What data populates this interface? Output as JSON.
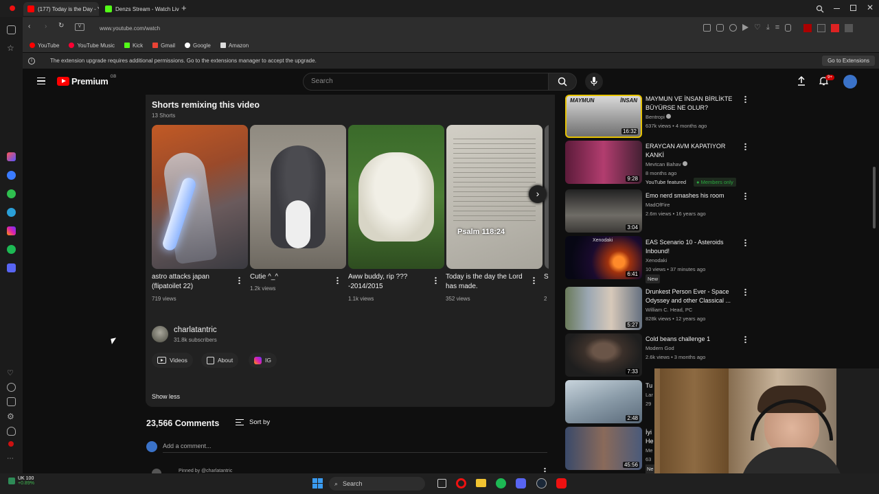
{
  "browser": {
    "tabs": [
      {
        "label": "(177) Today is the Day - Y"
      },
      {
        "label": "Denzs Stream - Watch Liv"
      }
    ],
    "url": "www.youtube.com/watch",
    "bookmarks": [
      "YouTube",
      "YouTube Music",
      "Kick",
      "Gmail",
      "Google",
      "Amazon"
    ],
    "info_message": "The extension upgrade requires additional permissions. Go to the extensions manager to accept the upgrade.",
    "info_button": "Go to Extensions"
  },
  "youtube": {
    "logo": "Premium",
    "logo_badge": "GB",
    "search_placeholder": "Search",
    "notifications_badge": "9+"
  },
  "shorts": {
    "heading": "Shorts remixing this video",
    "count": "13 Shorts",
    "items": [
      {
        "title": "astro attacks japan (flipatoilet 22)",
        "views": "719 views"
      },
      {
        "title": "Cutie ^_^",
        "views": "1.2k views"
      },
      {
        "title": "Aww buddy, rip ??? -2014/2015",
        "views": "1.1k views"
      },
      {
        "title": "Today is the day the Lord has made.",
        "views": "352 views"
      },
      {
        "title": "S",
        "views": "2"
      }
    ],
    "psalm_text": "Psalm 118:24"
  },
  "channel": {
    "name": "charlatantric",
    "subscribers": "31.8k subscribers",
    "chips": [
      "Videos",
      "About",
      "IG"
    ],
    "show_less": "Show less"
  },
  "comments": {
    "count": "23,566 Comments",
    "sort": "Sort by",
    "add_placeholder": "Add a comment...",
    "pinned": "Pinned by @charlatantric"
  },
  "related": [
    {
      "title": "MAYMUN VE İNSAN BİRLİKTE BÜYÜRSE NE OLUR?",
      "channel": "Bentropi",
      "meta": "637k views • 4 months ago",
      "duration": "16:32",
      "thumb_text_left": "MAYMUN",
      "thumb_text_right": "İNSAN"
    },
    {
      "title": "ERAYCAN AVM KAPATIYOR KANKİ",
      "channel": "Mevtcan Bahav",
      "meta": "8 months ago",
      "duration": "9:28",
      "badge1": "YouTube featured",
      "badge2": "Members only"
    },
    {
      "title": "Emo nerd smashes his room",
      "channel": "MadOfFire",
      "meta": "2.6m views • 16 years ago",
      "duration": "3:04"
    },
    {
      "title": "EAS Scenario 10 - Asteroids Inbound!",
      "channel": "Xenodaki",
      "meta": "10 views • 37 minutes ago",
      "duration": "6:41",
      "badge1": "New",
      "thumb_text": "Xenodaki"
    },
    {
      "title": "Drunkest Person Ever - Space Odyssey and other Classical ...",
      "channel": "William C. Head, PC",
      "meta": "828k views • 12 years ago",
      "duration": "5:27"
    },
    {
      "title": "Cold beans challenge 1",
      "channel": "Modern God",
      "meta": "2.6k views • 3 months ago",
      "duration": "7:33"
    },
    {
      "title": "Tu",
      "channel": "Lar",
      "meta": "29",
      "duration": "2:48"
    },
    {
      "title": "İyi He",
      "channel": "Me",
      "meta": "63",
      "duration": "45:56",
      "badge1": "Ne"
    }
  ],
  "taskbar": {
    "stock_name": "UK 100",
    "stock_change": "+0.89%",
    "search": "Search"
  }
}
